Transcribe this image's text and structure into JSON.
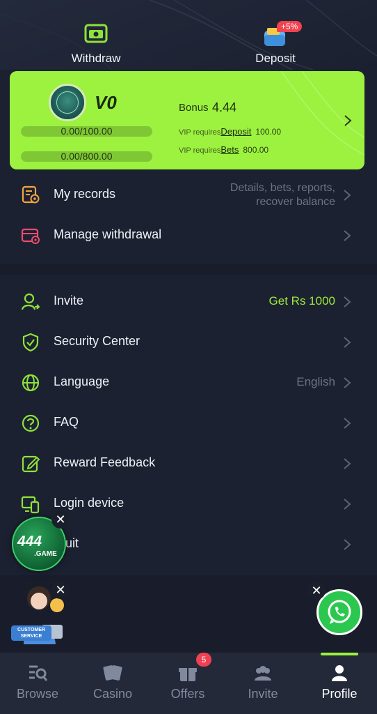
{
  "quick_actions": {
    "withdraw_label": "Withdraw",
    "deposit_label": "Deposit",
    "deposit_badge": "+5%"
  },
  "vip_card": {
    "level": "V0",
    "progress1_text": "0.00/100.00",
    "progress1_fraction": 0.0,
    "progress2_text": "0.00/800.00",
    "progress2_fraction": 0.0,
    "bonus_label": "Bonus",
    "bonus_value": "4.44",
    "req1_prefix": "VIP requires",
    "req1_key": "Deposit",
    "req1_value": "100.00",
    "req2_prefix": "VIP requires",
    "req2_key": "Bets",
    "req2_value": "800.00",
    "background_color": "#9cf23f"
  },
  "menu_top": [
    {
      "label": "My records",
      "value_line1": "Details, bets, reports,",
      "value_line2": "recover balance",
      "icon": "records-icon"
    },
    {
      "label": "Manage withdrawal",
      "value": "",
      "icon": "wallet-gear-icon"
    }
  ],
  "menu_main": [
    {
      "label": "Invite",
      "value": "Get Rs 1000",
      "icon": "invite-user-icon"
    },
    {
      "label": "Security Center",
      "value": "",
      "icon": "shield-check-icon"
    },
    {
      "label": "Language",
      "value": "English",
      "icon": "globe-icon"
    },
    {
      "label": "FAQ",
      "value": "",
      "icon": "question-circle-icon"
    },
    {
      "label": "Reward Feedback",
      "value": "",
      "icon": "edit-icon"
    },
    {
      "label": "Login device",
      "value": "",
      "icon": "devices-icon"
    },
    {
      "label": "uit",
      "value": "",
      "icon": "quit-icon"
    }
  ],
  "floating": {
    "logo_text_main": "444",
    "logo_text_sub": ".GAME",
    "close_symbol": "✕",
    "cs_line1": "CUSTOMER",
    "cs_line2": "SERVICE"
  },
  "tabs": [
    {
      "label": "Browse",
      "icon": "browse-icon",
      "active": false
    },
    {
      "label": "Casino",
      "icon": "cards-icon",
      "active": false
    },
    {
      "label": "Offers",
      "icon": "gift-icon",
      "active": false,
      "badge": "5"
    },
    {
      "label": "Invite",
      "icon": "people-icon",
      "active": false
    },
    {
      "label": "Profile",
      "icon": "profile-icon",
      "active": true
    }
  ],
  "colors": {
    "accent": "#9cf23f",
    "background": "#1c2131",
    "badge": "#ee4153",
    "whatsapp": "#2cc74f"
  }
}
